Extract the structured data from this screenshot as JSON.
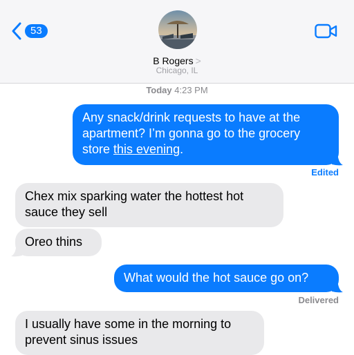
{
  "header": {
    "back_count": "53",
    "contact_name": "B Rogers",
    "contact_chevron": ">",
    "contact_location": "Chicago, IL",
    "accent_color": "#0a7cff"
  },
  "conversation": {
    "timestamp_day": "Today",
    "timestamp_time": "4:23 PM",
    "messages": [
      {
        "direction": "outgoing",
        "text_before_link": "Any snack/drink requests to have at the apartment? I’m gonna go to the grocery store ",
        "link_text": "this evening",
        "text_after_link": ".",
        "status": "Edited"
      },
      {
        "direction": "incoming",
        "text": "Chex mix sparking water the hottest hot sauce they sell"
      },
      {
        "direction": "incoming",
        "text": "Oreo thins"
      },
      {
        "direction": "outgoing",
        "text": "What would the hot sauce go on?",
        "status": "Delivered"
      },
      {
        "direction": "incoming",
        "text": "I usually have some in the morning to prevent sinus issues"
      }
    ]
  },
  "icons": {
    "back": "chevron-left-icon",
    "video": "video-camera-icon",
    "avatar": "contact-photo"
  },
  "colors": {
    "outgoing_bubble": "#0a7cff",
    "incoming_bubble": "#e9e9eb",
    "header_bg": "#f6f6f8"
  }
}
